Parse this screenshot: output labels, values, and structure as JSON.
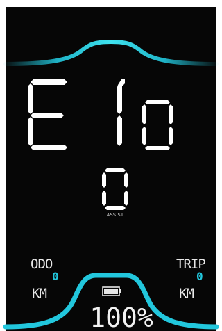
{
  "display": {
    "accent_color": "#22c7dd",
    "background_color": "#060606",
    "segment_color": "#ffffff"
  },
  "error": {
    "prefix": "E",
    "code": "10"
  },
  "assist": {
    "level": "0",
    "label": "ASSIST"
  },
  "odo": {
    "label": "ODO",
    "value": "0",
    "unit": "KM"
  },
  "trip": {
    "label": "TRIP",
    "value": "0",
    "unit": "KM"
  },
  "battery": {
    "icon": "battery-icon",
    "percent_text": "100%",
    "level": 1.0
  }
}
